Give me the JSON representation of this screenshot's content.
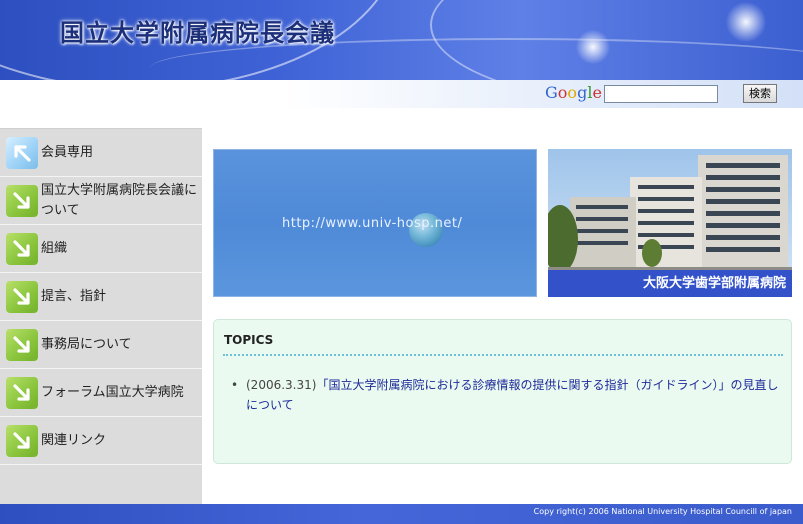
{
  "header": {
    "site_title": "国立大学附属病院長会議"
  },
  "search": {
    "logo": "Google",
    "input_value": "",
    "button_label": "検索"
  },
  "sidebar": {
    "items": [
      {
        "label": "会員専用",
        "icon": "arrow-up-left-icon",
        "color": "#8fcbf2"
      },
      {
        "label": "国立大学附属病院長会議について",
        "icon": "arrow-down-right-icon",
        "color": "#8cc63f"
      },
      {
        "label": "組織",
        "icon": "arrow-down-right-icon",
        "color": "#8cc63f"
      },
      {
        "label": "提言、指針",
        "icon": "arrow-down-right-icon",
        "color": "#8cc63f"
      },
      {
        "label": "事務局について",
        "icon": "arrow-down-right-icon",
        "color": "#8cc63f"
      },
      {
        "label": "フォーラム国立大学病院",
        "icon": "arrow-down-right-icon",
        "color": "#8cc63f"
      },
      {
        "label": "関連リンク",
        "icon": "arrow-down-right-icon",
        "color": "#8cc63f"
      }
    ]
  },
  "main": {
    "url_banner": "http://www.univ-hosp.net/",
    "hospital_caption": "大阪大学歯学部附属病院",
    "topics": {
      "title": "TOPICS",
      "items": [
        {
          "date": "(2006.3.31)",
          "link": "「国立大学附属病院における診療情報の提供に関する指針（ガイドライン）」の見直しについて"
        }
      ]
    }
  },
  "footer": {
    "copyright": "Copy right(c) 2006 National University Hospital Councill of japan"
  },
  "colors": {
    "header_blue": "#3f63d6",
    "sidebar_bg": "#dcdcdc",
    "arrow_green": "#8cc63f",
    "arrow_blue": "#8fcbf2",
    "topics_bg": "#eafaf0",
    "link": "#1f2a9a",
    "caption_bg": "#3352c9"
  }
}
